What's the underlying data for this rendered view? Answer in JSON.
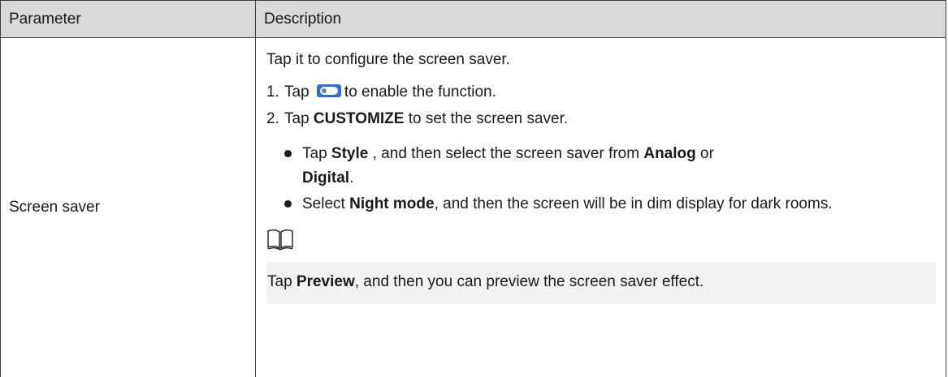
{
  "table": {
    "headers": [
      "Parameter",
      "Description"
    ],
    "row": {
      "parameter": "Screen saver",
      "intro": "Tap it to configure the screen saver.",
      "step1": {
        "num": "1.",
        "pre": "Tap",
        "post": "to enable the function."
      },
      "step2": {
        "num": "2.",
        "pre": "Tap",
        "bold": "CUSTOMIZE",
        "post": " to set the screen saver."
      },
      "bullet1": {
        "pre": "Tap ",
        "bold1": "Style",
        "mid": " , and then select the screen saver from ",
        "bold2": "Analog",
        "mid2": " or ",
        "bold3": "Digital",
        "end": "."
      },
      "bullet2": {
        "pre": "Select ",
        "bold": "Night mode",
        "post": ", and then the screen will be in dim display for dark rooms."
      },
      "note": {
        "icon": "book-note-icon",
        "pre": "Tap ",
        "bold": "Preview",
        "post": ", and then you can preview the screen saver effect."
      }
    }
  },
  "colors": {
    "header_bg": "#d9d9d9",
    "toggle": "#2f6fd2",
    "note_bg": "#f2f2f2"
  }
}
